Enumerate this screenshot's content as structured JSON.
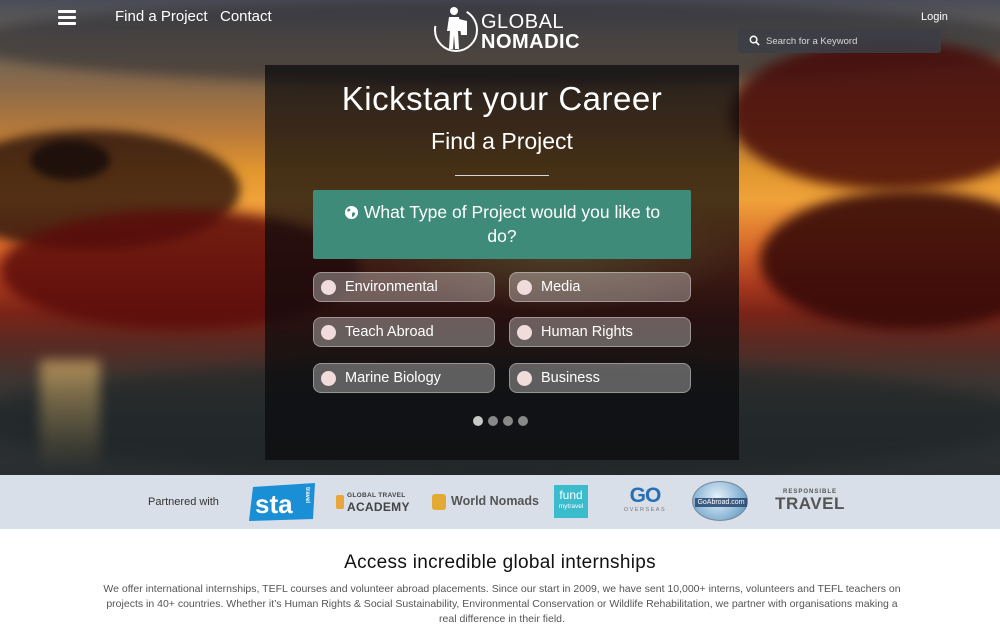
{
  "nav": {
    "find_project": "Find a Project",
    "contact": "Contact",
    "login": "Login",
    "search_placeholder": "Search for a Keyword"
  },
  "logo": {
    "line1": "GLOBAL",
    "line2": "NOMADIC"
  },
  "hero": {
    "title": "Kickstart your Career",
    "subtitle": "Find a Project",
    "question": "What Type of Project would you like to do?",
    "options": [
      "Environmental",
      "Media",
      "Teach Abroad",
      "Human Rights",
      "Marine Biology",
      "Business"
    ],
    "slides": 4,
    "active_slide": 1
  },
  "partners": {
    "label": "Partnered with",
    "logos": {
      "sta": "sta",
      "sta_tag": "travel",
      "gta_small": "GLOBAL TRAVEL",
      "gta_big": "ACADEMY",
      "world_nomads": "World Nomads",
      "fund_a": "fund",
      "fund_b": "mytravel",
      "go_big": "GO",
      "go_small": "OVERSEAS",
      "goabroad": "GoAbroad.com",
      "rt_small": "RESPONSIBLE",
      "rt_big": "TRAVEL"
    }
  },
  "intro": {
    "title": "Access incredible global internships",
    "text": "We offer international internships, TEFL courses and volunteer abroad placements. Since our start in 2009, we have sent 10,000+ interns, volunteers and TEFL teachers on projects in 40+ countries. Whether it’s Human Rights & Social Sustainability, Environmental Conservation or Wildlife Rehabilitation, we partner with organisations making a real difference in their field."
  },
  "colors": {
    "question_bg": "#3f8b79",
    "panel_bg": "rgba(10,10,12,0.72)",
    "partners_bg": "#d8dfe8"
  }
}
